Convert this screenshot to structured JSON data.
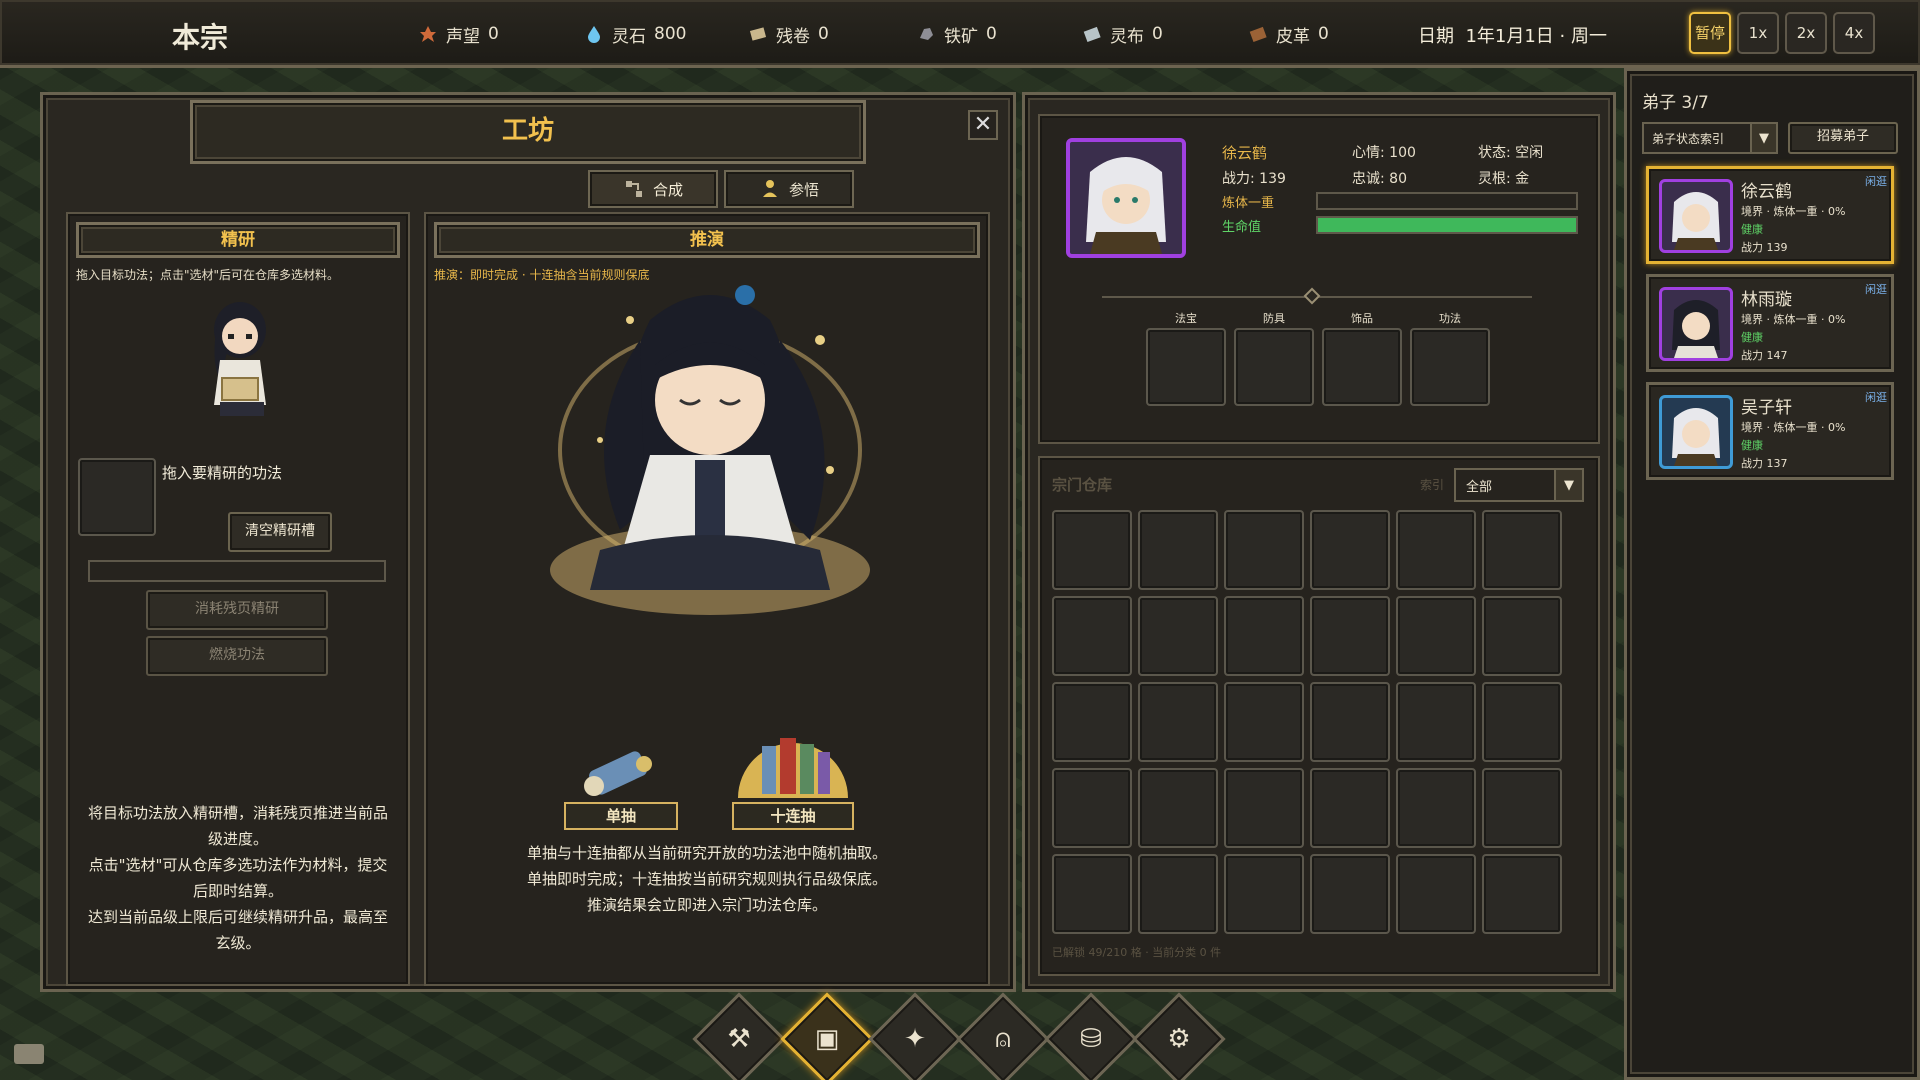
{
  "colors": {
    "gold": "#f2c14e",
    "health_green": "#5fd467",
    "accent_selected": "#e4b233",
    "purple_frame": "#a040e0",
    "blue_frame": "#3f9bd6"
  },
  "topbar": {
    "sect_name": "本宗",
    "resources": [
      {
        "icon": "prestige-icon",
        "label": "声望",
        "value": "0"
      },
      {
        "icon": "spirit-stone-icon",
        "label": "灵石",
        "value": "800"
      },
      {
        "icon": "scroll-fragment-icon",
        "label": "残卷",
        "value": "0"
      },
      {
        "icon": "iron-ore-icon",
        "label": "铁矿",
        "value": "0"
      },
      {
        "icon": "spirit-cloth-icon",
        "label": "灵布",
        "value": "0"
      },
      {
        "icon": "leather-icon",
        "label": "皮革",
        "value": "0"
      }
    ],
    "date_label": "日期",
    "date_value": "1年1月1日 · 周一",
    "speed_buttons": [
      "暂停",
      "1x",
      "2x",
      "4x"
    ],
    "active_speed": "暂停"
  },
  "workshop": {
    "title": "工坊",
    "tabs": [
      {
        "label": "合成",
        "icon": "synthesis-icon"
      },
      {
        "label": "参悟",
        "icon": "comprehend-icon"
      }
    ],
    "refine": {
      "title": "精研",
      "hint": "拖入目标功法；点击\"选材\"后可在仓库多选材料。",
      "drop_label": "拖入要精研的功法",
      "clear_button": "清空精研槽",
      "consume_button": "消耗残页精研",
      "burn_button": "燃烧功法",
      "desc_lines": [
        "将目标功法放入精研槽，消耗残页推进当前品",
        "级进度。",
        "点击\"选材\"可从仓库多选功法作为材料，提交",
        "后即时结算。",
        "达到当前品级上限后可继续精研升品，最高至",
        "玄级。"
      ]
    },
    "deduce": {
      "title": "推演",
      "hint": "推演：即时完成 · 十连抽含当前规则保底",
      "single_draw": "单抽",
      "ten_draw": "十连抽",
      "desc_lines": [
        "单抽与十连抽都从当前研究开放的功法池中随机抽取。",
        "单抽即时完成；十连抽按当前研究规则执行品级保底。",
        "推演结果会立即进入宗门功法仓库。"
      ]
    }
  },
  "character": {
    "name": "徐云鹤",
    "combat_power_label": "战力:",
    "combat_power": "139",
    "mood_label": "心情:",
    "mood": "100",
    "loyalty_label": "忠诚:",
    "loyalty": "80",
    "status_label": "状态:",
    "status": "空闲",
    "root_label": "灵根:",
    "root": "金",
    "realm": "炼体一重",
    "realm_progress": 0,
    "hp_label": "生命值",
    "hp_fraction": 1.0,
    "equip_slots": [
      "法宝",
      "防具",
      "饰品",
      "功法"
    ]
  },
  "warehouse": {
    "title": "宗门仓库",
    "filter_label": "索引",
    "filter_value": "全部",
    "footer": "已解锁 49/210 格 · 当前分类 0 件",
    "rows": 5,
    "cols": 6
  },
  "disciples": {
    "header": "弟子 3/7",
    "filter_value": "弟子状态索引",
    "recruit_button": "招募弟子",
    "list": [
      {
        "name": "徐云鹤",
        "status": "闲逛",
        "realm": "境界 · 炼体一重 · 0%",
        "health": "健康",
        "power": "战力 139",
        "frame": "purple",
        "selected": true
      },
      {
        "name": "林雨璇",
        "status": "闲逛",
        "realm": "境界 · 炼体一重 · 0%",
        "health": "健康",
        "power": "战力 147",
        "frame": "purple",
        "selected": false
      },
      {
        "name": "吴子轩",
        "status": "闲逛",
        "realm": "境界 · 炼体一重 · 0%",
        "health": "健康",
        "power": "战力 137",
        "frame": "blue",
        "selected": false
      }
    ]
  },
  "bottom_nav": [
    {
      "name": "forge-anvil-icon",
      "active": false
    },
    {
      "name": "workshop-chest-icon",
      "active": true
    },
    {
      "name": "sparkle-icon",
      "active": false
    },
    {
      "name": "bell-icon",
      "active": false
    },
    {
      "name": "coins-icon",
      "active": false
    },
    {
      "name": "gear-icon",
      "active": false
    }
  ]
}
